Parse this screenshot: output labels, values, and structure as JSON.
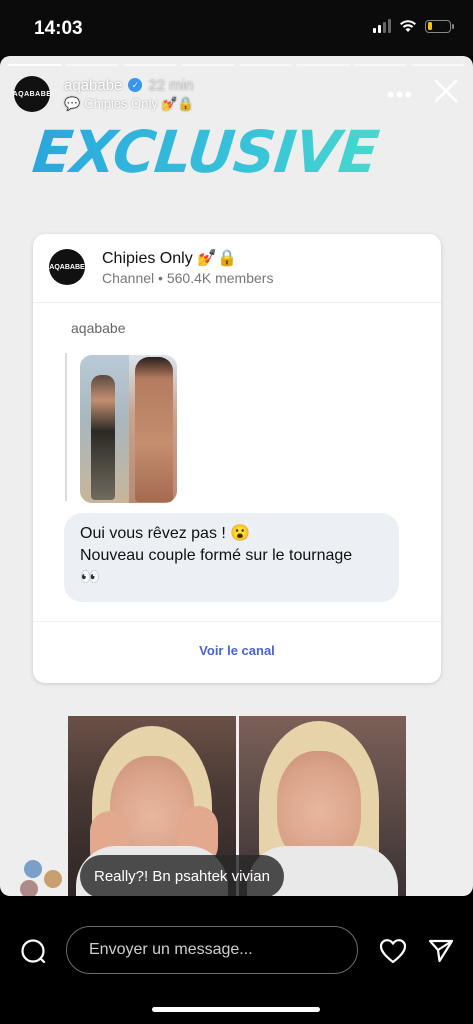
{
  "status_bar": {
    "time": "14:03",
    "battery_level": 0.2,
    "icons": [
      "signal-icon",
      "wifi-icon",
      "battery-icon"
    ]
  },
  "story": {
    "progress_segments": 8,
    "active_segment": 0,
    "author": {
      "username": "aqababe",
      "avatar_text": "AQABABE",
      "verified": true,
      "time_ago": "22 min",
      "subtitle": "Chipies Only 💅🔒"
    },
    "headline": "EXCLUSIVE",
    "channel_card": {
      "avatar_text": "AQABABE",
      "name": "Chipies Only 💅🔒",
      "meta": "Channel • 560.4K members",
      "post_author": "aqababe",
      "message_line1": "Oui vous rêvez pas ! 😮",
      "message_line2": "Nouveau couple formé sur le tournage",
      "message_line3": "👀",
      "cta": "Voir le canal"
    },
    "comment": "Really?! Bn psahtek vivian"
  },
  "bottom_bar": {
    "message_placeholder": "Envoyer un message..."
  },
  "colors": {
    "headline_start": "#2aa7de",
    "headline_end": "#4fe3c8",
    "link": "#4a63d0",
    "battery": "#f2c40f"
  }
}
